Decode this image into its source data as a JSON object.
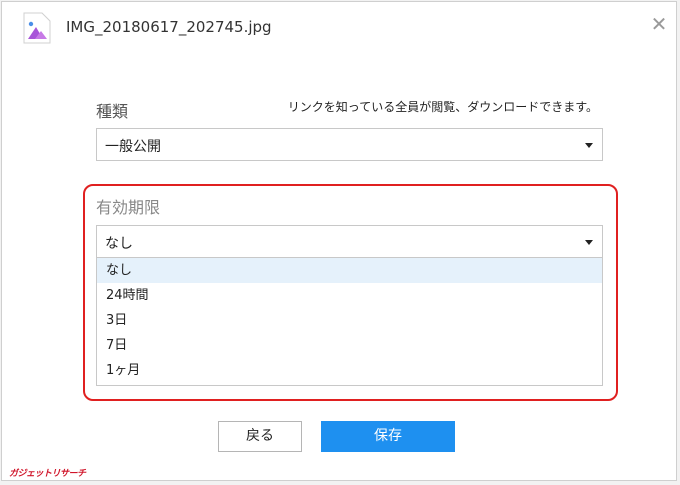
{
  "window": {
    "title": "IMG_20180617_202745.jpg",
    "close_glyph": "✕"
  },
  "type": {
    "label": "種類",
    "hint": "リンクを知っている全員が閲覧、ダウンロードできます。",
    "selected": "一般公開"
  },
  "expiration": {
    "label": "有効期限",
    "selected": "なし",
    "options": [
      "なし",
      "24時間",
      "3日",
      "7日",
      "1ヶ月"
    ]
  },
  "buttons": {
    "back": "戻る",
    "save": "保存"
  },
  "watermark": "ガジェットリサーチ",
  "colors": {
    "accent": "#1e90f0",
    "highlight": "#e02020",
    "selected_option": "#e5f1fb"
  },
  "icons": {
    "file": "image-file-icon",
    "close": "close-icon",
    "dropdown": "chevron-down-icon"
  }
}
